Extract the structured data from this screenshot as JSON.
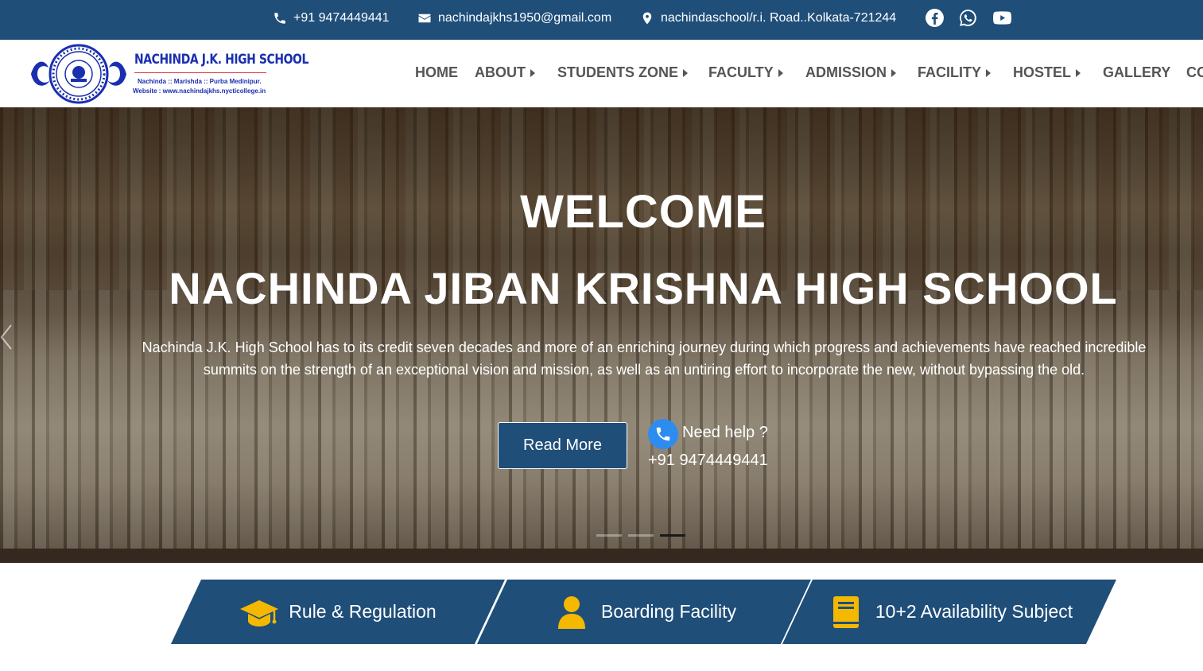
{
  "topbar": {
    "phone": "+91 9474449441",
    "email": "nachindajkhs1950@gmail.com",
    "address": "nachindaschool/r.i. Road..Kolkata-721244",
    "social": [
      "facebook-icon",
      "whatsapp-icon",
      "youtube-icon"
    ]
  },
  "logo": {
    "title": "NACHINDA J.K. HIGH SCHOOL",
    "line1": "Nachinda :: Marishda :: Purba Medinipur.",
    "line2": "Website : www.nachindajkhs.nycticollege.in"
  },
  "nav": {
    "home": "HOME",
    "about": "ABOUT",
    "students": "STUDENTS ZONE",
    "faculty": "FACULTY",
    "admission": "ADMISSION",
    "facility": "FACILITY",
    "hostel": "HOSTEL",
    "gallery": "GALLERY",
    "contact": "CO"
  },
  "hero": {
    "welcome": "WELCOME",
    "title": "NACHINDA JIBAN KRISHNA HIGH SCHOOL",
    "desc": "Nachinda J.K. High School has to its credit seven decades and more of an enriching journey during which progress and achievements have reached incredible summits on the strength of an exceptional vision and mission, as well as an untiring effort to incorporate the new, without bypassing the old.",
    "read_more": "Read More",
    "help_label": "Need help ?",
    "help_phone": "+91 9474449441",
    "slides": 3,
    "active_slide": 3
  },
  "features": [
    {
      "label": "Rule & Regulation",
      "icon": "graduation-cap-icon"
    },
    {
      "label": "Boarding Facility",
      "icon": "user-icon"
    },
    {
      "label": "10+2 Availability Subject",
      "icon": "book-icon"
    }
  ],
  "colors": {
    "brand": "#1f4e79",
    "accent": "#f5b800"
  }
}
